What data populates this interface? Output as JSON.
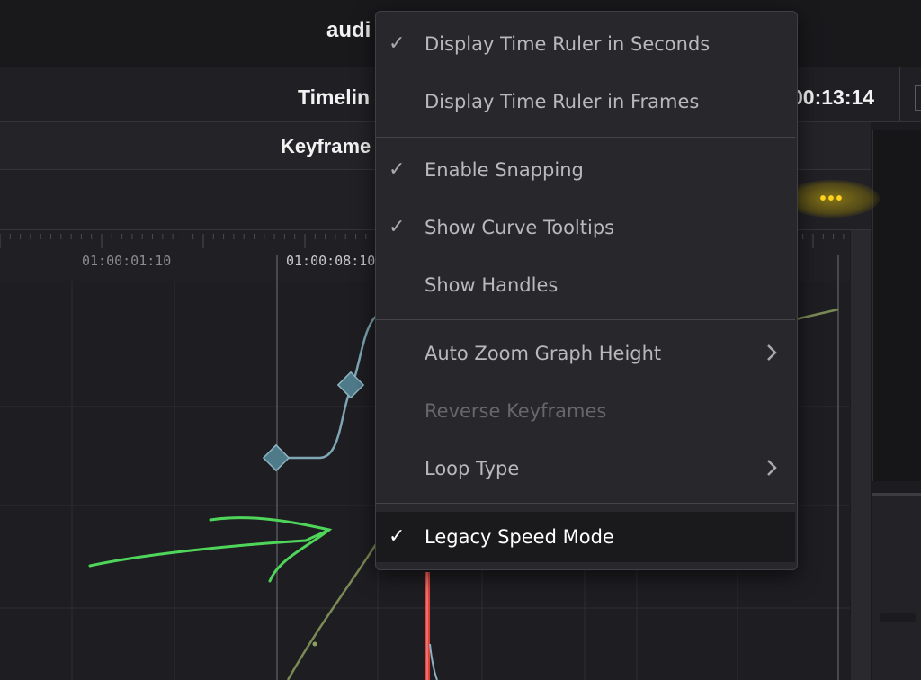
{
  "title_bar": {
    "title": "audi"
  },
  "timeline_row": {
    "title": "Timelin",
    "timecode": "00:13:14"
  },
  "keyframes_panel": {
    "title": "Keyframe",
    "more_button": "•••"
  },
  "ruler": {
    "labels": [
      "01:00:01:10",
      "01:00:08:10"
    ]
  },
  "menu": {
    "items": [
      {
        "label": "Display Time Ruler in Seconds",
        "checked": true,
        "enabled": true,
        "submenu": false
      },
      {
        "label": "Display Time Ruler in Frames",
        "checked": false,
        "enabled": true,
        "submenu": false
      },
      {
        "label": "Enable Snapping",
        "checked": true,
        "enabled": true,
        "submenu": false
      },
      {
        "label": "Show Curve Tooltips",
        "checked": true,
        "enabled": true,
        "submenu": false
      },
      {
        "label": "Show Handles",
        "checked": false,
        "enabled": true,
        "submenu": false
      },
      {
        "label": "Auto Zoom Graph Height",
        "checked": false,
        "enabled": true,
        "submenu": true
      },
      {
        "label": "Reverse Keyframes",
        "checked": false,
        "enabled": false,
        "submenu": false
      },
      {
        "label": "Loop Type",
        "checked": false,
        "enabled": true,
        "submenu": true
      },
      {
        "label": "Legacy Speed Mode",
        "checked": true,
        "enabled": true,
        "submenu": false,
        "highlighted": true
      }
    ],
    "check_glyph": "✓"
  },
  "colors": {
    "accent_yellow": "#ffd21f",
    "curve_blue": "#7fa6b5",
    "curve_green": "#7a8a55",
    "annotation_green": "#4fd65a",
    "playhead_red": "#e0423c"
  }
}
